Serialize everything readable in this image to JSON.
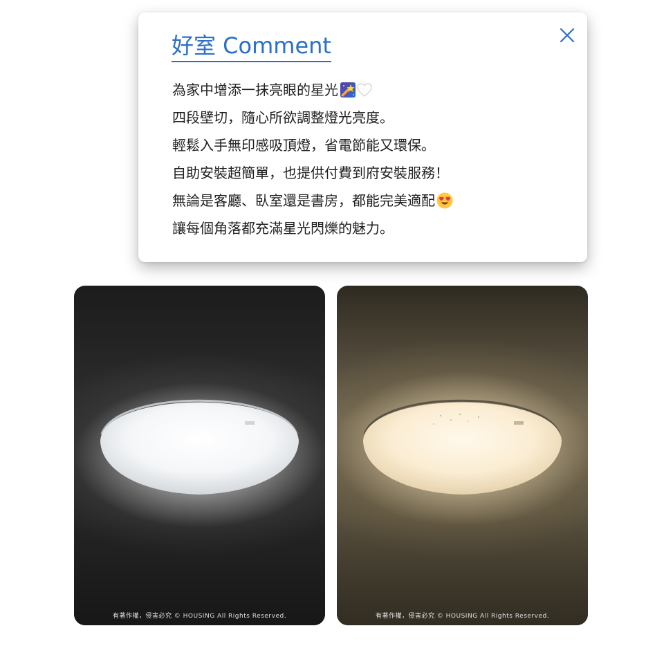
{
  "comment": {
    "title": "好室 Comment",
    "lines": [
      {
        "text": "為家中增添一抹亮眼的星光",
        "emojis": [
          "shooting-star-icon",
          "white-heart-icon"
        ]
      },
      {
        "text": "四段壁切，隨心所欲調整燈光亮度。"
      },
      {
        "text": "輕鬆入手無印感吸頂燈，省電節能又環保。"
      },
      {
        "text": "自助安裝超簡單，也提供付費到府安裝服務！"
      },
      {
        "text": "無論是客廳、臥室還是書房，都能完美適配",
        "emojis": [
          "smiling-face-heart-eyes-icon"
        ]
      },
      {
        "text": "讓每個角落都充滿星光閃爍的魅力。"
      }
    ],
    "close_icon": "close-icon"
  },
  "photos": [
    {
      "name": "ceiling-lamp-cool-white-photo",
      "watermark": "有著作權，侵害必究 © HOUSING All Rights Reserved."
    },
    {
      "name": "ceiling-lamp-warm-white-photo",
      "watermark": "有著作權，侵害必究 © HOUSING All Rights Reserved."
    }
  ],
  "colors": {
    "accent": "#2b6fc6",
    "text": "#1f1f1f"
  }
}
